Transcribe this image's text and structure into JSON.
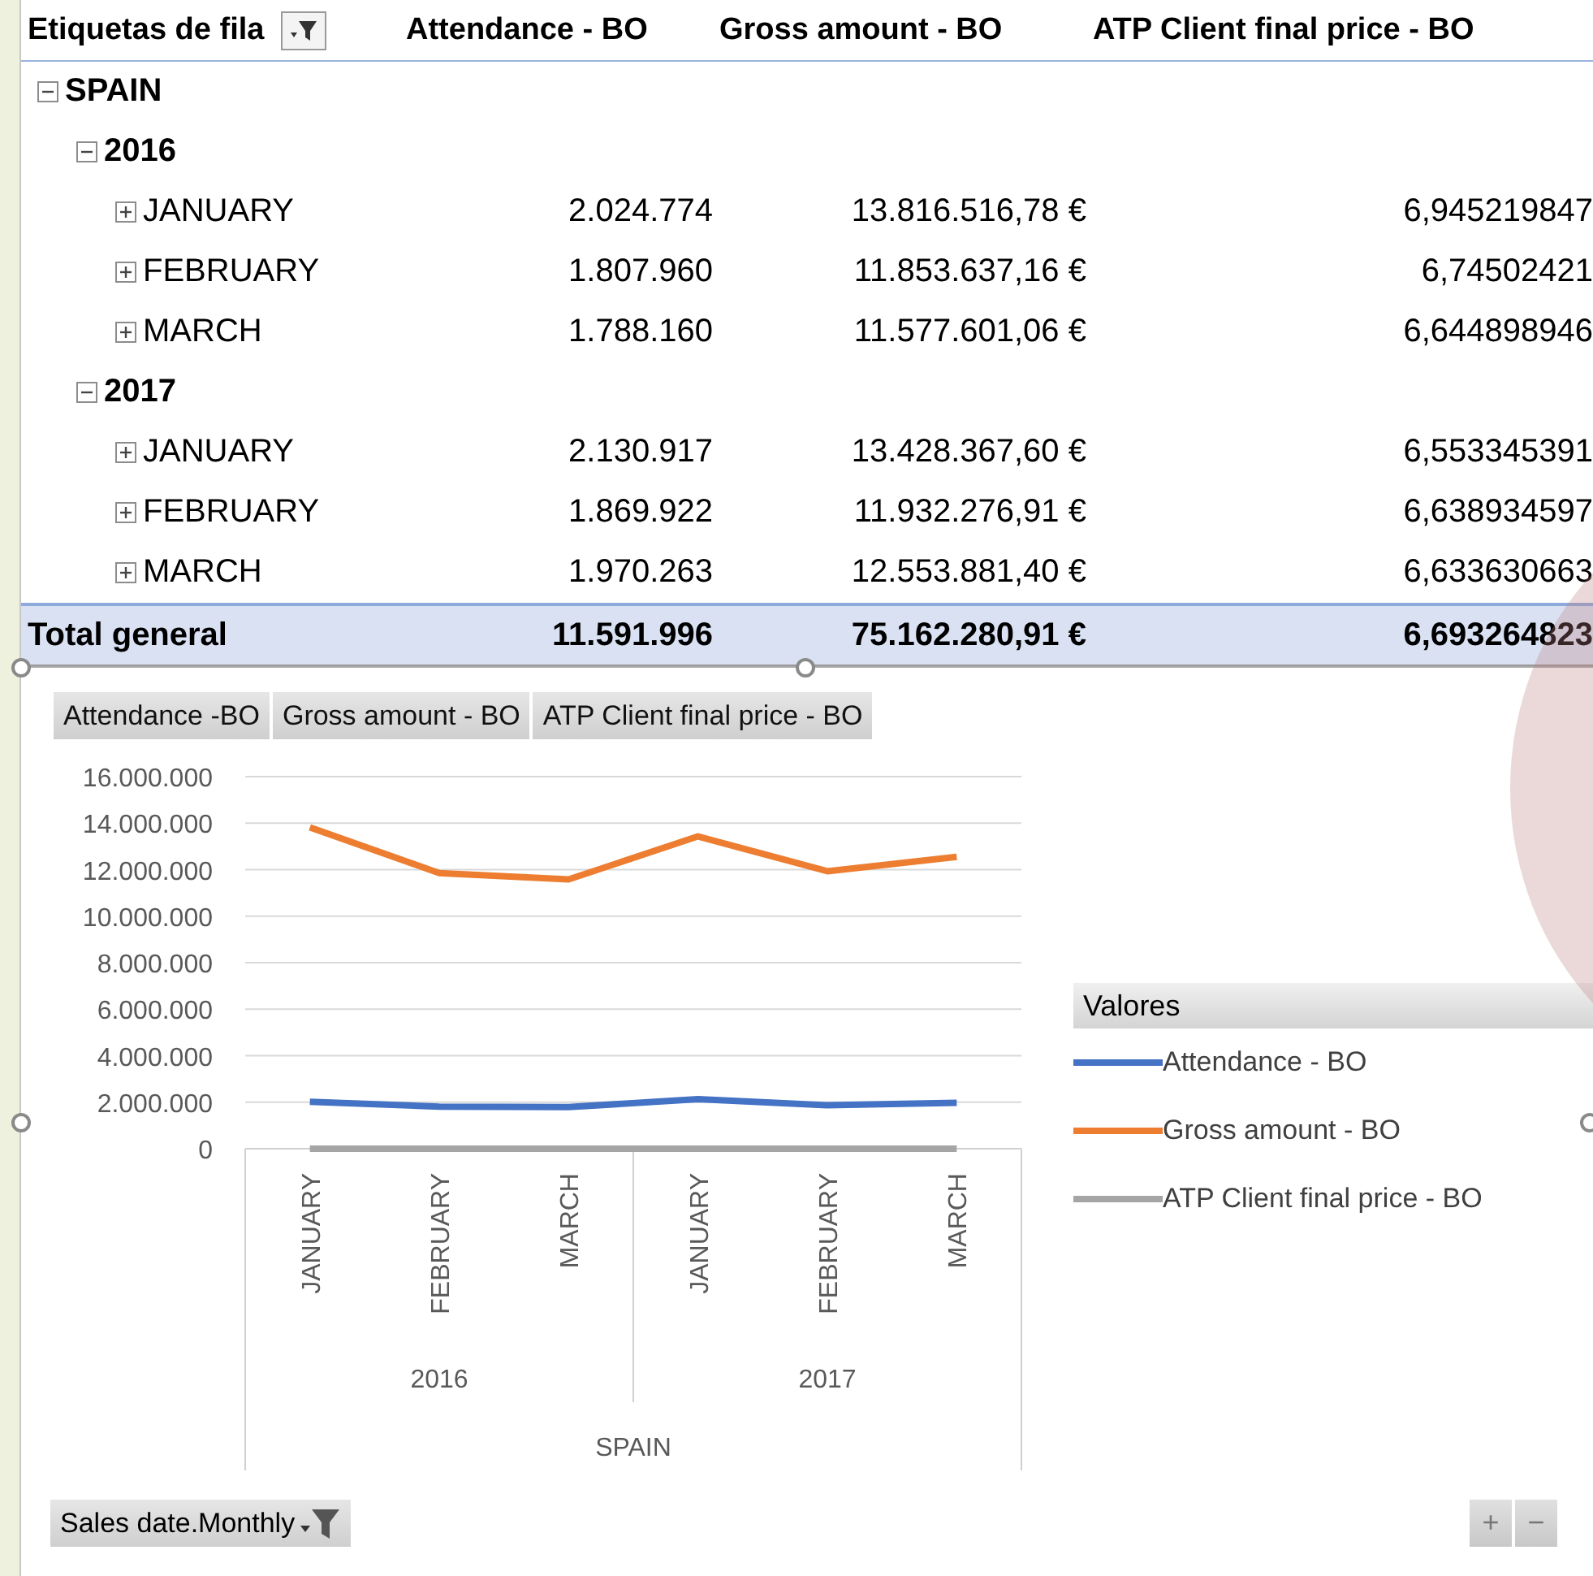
{
  "pivot": {
    "columns": [
      "Etiquetas de fila",
      "Attendance - BO",
      "Gross amount - BO",
      "ATP Client final price - BO"
    ],
    "rows": [
      {
        "label": "SPAIN",
        "expanded": true,
        "children": [
          {
            "label": "2016",
            "expanded": true,
            "children": [
              {
                "label": "JANUARY",
                "expanded": false,
                "values": [
                  "2.024.774",
                  "13.816.516,78 €",
                  "6,945219847"
                ]
              },
              {
                "label": "FEBRUARY",
                "expanded": false,
                "values": [
                  "1.807.960",
                  "11.853.637,16 €",
                  "6,74502421"
                ]
              },
              {
                "label": "MARCH",
                "expanded": false,
                "values": [
                  "1.788.160",
                  "11.577.601,06 €",
                  "6,644898946"
                ]
              }
            ]
          },
          {
            "label": "2017",
            "expanded": true,
            "children": [
              {
                "label": "JANUARY",
                "expanded": false,
                "values": [
                  "2.130.917",
                  "13.428.367,60 €",
                  "6,553345391"
                ]
              },
              {
                "label": "FEBRUARY",
                "expanded": false,
                "values": [
                  "1.869.922",
                  "11.932.276,91 €",
                  "6,638934597"
                ]
              },
              {
                "label": "MARCH",
                "expanded": false,
                "values": [
                  "1.970.263",
                  "12.553.881,40 €",
                  "6,633630663"
                ]
              }
            ]
          }
        ]
      }
    ],
    "total": {
      "label": "Total general",
      "values": [
        "11.591.996",
        "75.162.280,91 €",
        "6,693264823"
      ]
    }
  },
  "chart": {
    "fields": [
      "Attendance -BO",
      "Gross amount - BO",
      "ATP Client final price - BO"
    ],
    "chart_data": {
      "type": "line",
      "grid": true,
      "categories": [
        "JANUARY",
        "FEBRUARY",
        "MARCH",
        "JANUARY",
        "FEBRUARY",
        "MARCH"
      ],
      "ylim": [
        0,
        16000000
      ],
      "yticks": [
        {
          "value": 0,
          "label": "0"
        },
        {
          "value": 2000000,
          "label": "2.000.000"
        },
        {
          "value": 4000000,
          "label": "4.000.000"
        },
        {
          "value": 6000000,
          "label": "6.000.000"
        },
        {
          "value": 8000000,
          "label": "8.000.000"
        },
        {
          "value": 10000000,
          "label": "10.000.000"
        },
        {
          "value": 12000000,
          "label": "12.000.000"
        },
        {
          "value": 14000000,
          "label": "14.000.000"
        },
        {
          "value": 16000000,
          "label": "16.000.000"
        }
      ],
      "series": [
        {
          "name": "Attendance - BO",
          "color": "#4472c4",
          "values": [
            2020000,
            1810000,
            1790000,
            2130000,
            1870000,
            1970000
          ]
        },
        {
          "name": "Gross amount - BO",
          "color": "#ed7d31",
          "values": [
            13820000,
            11850000,
            11580000,
            13430000,
            11930000,
            12550000
          ]
        },
        {
          "name": "ATP Client final price - BO",
          "color": "#a5a5a5",
          "values": [
            7,
            7,
            7,
            7,
            7,
            7
          ]
        }
      ]
    },
    "year_groups": [
      "2016",
      "2017"
    ],
    "country_group": "SPAIN",
    "legend": {
      "title": "Valores"
    },
    "filter_field": "Sales date.Monthly",
    "zoom_buttons": [
      "+",
      "−"
    ]
  }
}
